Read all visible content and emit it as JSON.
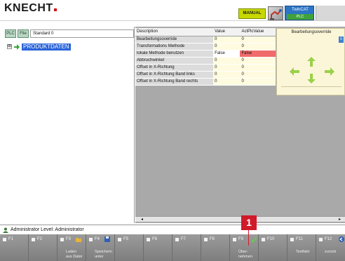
{
  "header": {
    "brand": "KNECHT",
    "mode_badge": "MANUAL",
    "twincat_title": "TwinCAT",
    "twincat_sub": "PLC",
    "icons": [
      "robot-icon"
    ]
  },
  "left_panel": {
    "plc_button": "PLC",
    "file_button": "File",
    "file_name": "Standard 0",
    "tree": {
      "expand": "⊞",
      "label": "PRODUKTDATEN"
    }
  },
  "table": {
    "headers": {
      "description": "Description",
      "value": "Value",
      "plc": "ActPlcValue"
    },
    "rows": [
      {
        "description": "Bearbeitungsoverride",
        "value": "0",
        "plc": "0",
        "alert": false
      },
      {
        "description": "Transformations Methode",
        "value": "0",
        "plc": "0",
        "alert": false
      },
      {
        "description": "lokale Methode benutzen",
        "value": "False",
        "plc": "False",
        "alert": true
      },
      {
        "description": "Abbruchwinkel",
        "value": "0",
        "plc": "0",
        "alert": false
      },
      {
        "description": "Offset in X-Richtung",
        "value": "0",
        "plc": "0",
        "alert": false
      },
      {
        "description": "Offset in X-Richtung Band links",
        "value": "0",
        "plc": "0",
        "alert": false
      },
      {
        "description": "Offset in X-Richtung Band rechts",
        "value": "0",
        "plc": "0",
        "alert": false
      }
    ]
  },
  "override": {
    "title": "Bearbeitungsoverride",
    "value": "0",
    "arrow_color": "#9bd14a"
  },
  "scrollbar": {
    "left": "◂",
    "right": "▸"
  },
  "status": {
    "user_line": "Administrator  Level: Administrator"
  },
  "fkeys": [
    {
      "key": "F1",
      "caption": ""
    },
    {
      "key": "F2",
      "caption": ""
    },
    {
      "key": "F3",
      "caption": "Laden\naus Datei"
    },
    {
      "key": "F4",
      "caption": "Speichern\nunter"
    },
    {
      "key": "F5",
      "caption": ""
    },
    {
      "key": "F6",
      "caption": ""
    },
    {
      "key": "F7",
      "caption": ""
    },
    {
      "key": "F8",
      "caption": ""
    },
    {
      "key": "F9",
      "caption": "Über-\nnehmen"
    },
    {
      "key": "F10",
      "caption": ""
    },
    {
      "key": "F11",
      "caption": "Testfahr"
    },
    {
      "key": "F12",
      "caption": "zurück"
    }
  ],
  "callout": {
    "number": "1",
    "color": "#d01a2a"
  }
}
